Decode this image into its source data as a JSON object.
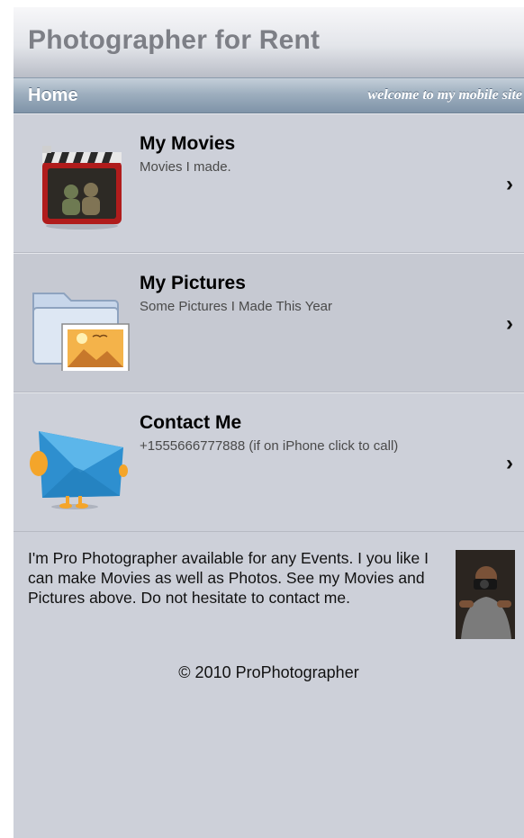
{
  "header": {
    "title": "Photographer for Rent"
  },
  "nav": {
    "home_label": "Home",
    "tagline": "welcome to my mobile site"
  },
  "list": [
    {
      "title": "My Movies",
      "subtitle": "Movies I made.",
      "icon": "movie-clapper-icon",
      "chevron": "›"
    },
    {
      "title": "My Pictures",
      "subtitle": "Some Pictures I Made This Year",
      "icon": "picture-folder-icon",
      "chevron": "›"
    },
    {
      "title": "Contact Me",
      "subtitle": "+1555666777888 (if on iPhone click to call)",
      "icon": "envelope-icon",
      "chevron": "›"
    }
  ],
  "about": {
    "text": "I'm Pro Photographer available for any Events. I you like I can make Movies as well as Photos. See my Movies and Pictures above. Do not hesitate to contact me.",
    "avatar": "photographer-avatar"
  },
  "footer": {
    "copyright": "© 2010 ProPhotographer"
  },
  "colors": {
    "background": "#cdd0d9",
    "nav_bar": "#9eafbf",
    "title_text": "#7d7f86"
  }
}
